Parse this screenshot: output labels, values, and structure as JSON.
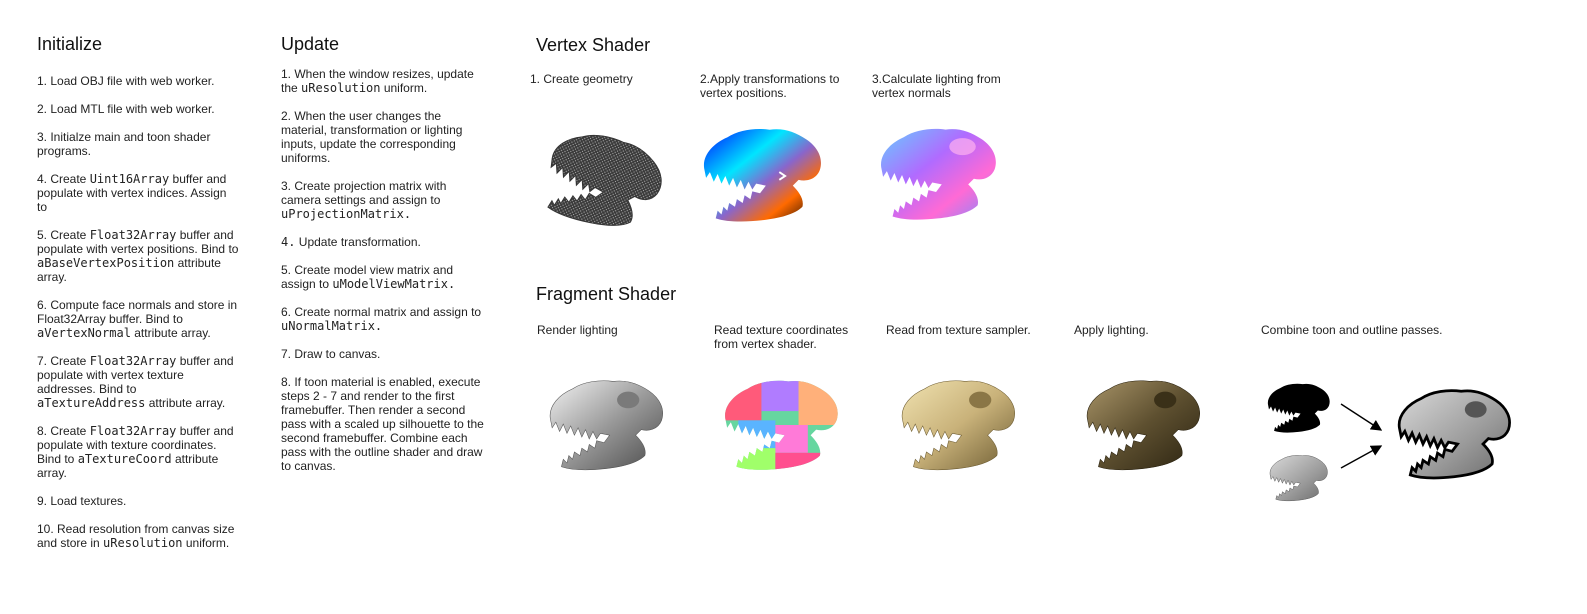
{
  "init": {
    "title": "Initialize",
    "steps": [
      {
        "parts": [
          {
            "t": "1. Load OBJ file with web worker."
          }
        ]
      },
      {
        "parts": [
          {
            "t": "2. Load MTL file with web worker."
          }
        ]
      },
      {
        "parts": [
          {
            "t": "3. Initialze main and toon shader programs."
          }
        ]
      },
      {
        "parts": [
          {
            "t": "4. Create "
          },
          {
            "c": "Uint16Array"
          },
          {
            "t": " buffer and populate with vertex indices.  Assign to"
          }
        ]
      },
      {
        "parts": [
          {
            "t": "5. Create "
          },
          {
            "c": "Float32Array"
          },
          {
            "t": " buffer and populate with vertex positions. Bind to "
          },
          {
            "c": "aBaseVertexPosition"
          },
          {
            "t": " attribute array."
          }
        ]
      },
      {
        "parts": [
          {
            "t": "6. Compute face normals and store in Float32Array buffer.  Bind to "
          },
          {
            "c": "aVertexNormal"
          },
          {
            "t": " attribute array."
          }
        ]
      },
      {
        "parts": [
          {
            "t": "7. Create "
          },
          {
            "c": "Float32Array"
          },
          {
            "t": " buffer and populate with vertex texture addresses. Bind to "
          },
          {
            "c": "aTextureAddress"
          },
          {
            "t": " attribute array."
          }
        ]
      },
      {
        "parts": [
          {
            "t": "8. Create "
          },
          {
            "c": "Float32Array"
          },
          {
            "t": " buffer and populate with texture coordinates. Bind to "
          },
          {
            "c": "aTextureCoord"
          },
          {
            "t": " attribute array."
          }
        ]
      },
      {
        "parts": [
          {
            "t": "9. Load textures."
          }
        ]
      },
      {
        "parts": [
          {
            "t": "10. Read resolution from canvas size and store in "
          },
          {
            "c": "uResolution"
          },
          {
            "t": " uniform."
          }
        ]
      }
    ]
  },
  "update": {
    "title": "Update",
    "steps": [
      {
        "parts": [
          {
            "t": "1. When the window resizes, update the "
          },
          {
            "c": "uResolution"
          },
          {
            "t": " uniform."
          }
        ]
      },
      {
        "parts": [
          {
            "t": "2. When the user changes the material, transformation or lighting inputs, update the corresponding uniforms."
          }
        ]
      },
      {
        "parts": [
          {
            "t": "3. Create projection matrix with camera settings and assign to "
          },
          {
            "c": "uProjectionMatrix."
          }
        ]
      },
      {
        "parts": [
          {
            "c": "4."
          },
          {
            "t": " Update transformation."
          }
        ]
      },
      {
        "parts": [
          {
            "t": "5. Create model view matrix and assign to "
          },
          {
            "c": "uModelViewMatrix."
          }
        ]
      },
      {
        "parts": [
          {
            "t": "6. Create normal matrix and assign to "
          },
          {
            "c": "uNormalMatrix."
          }
        ]
      },
      {
        "parts": [
          {
            "t": "7. Draw to canvas."
          }
        ]
      },
      {
        "parts": [
          {
            "t": "8. If toon material is enabled, execute steps 2 - 7 and render to the first framebuffer. Then render a second pass with a scaled up silhouette to the second framebuffer. Combine each pass with the outline shader and draw to canvas."
          }
        ]
      }
    ]
  },
  "vertex": {
    "title": "Vertex Shader",
    "captions": [
      "1. Create geometry",
      "2.Apply transformations to vertex positions.",
      "3.Calculate lighting from vertex normals"
    ]
  },
  "fragment": {
    "title": "Fragment Shader",
    "captions": [
      "Render lighting",
      "Read texture coordinates from vertex shader.",
      "Read from texture sampler.",
      "Apply lighting.",
      "Combine toon and outline passes."
    ]
  },
  "images": {
    "wireframe": "skull-wireframe-image",
    "transformed": "skull-transformed-image",
    "normals": "skull-normals-image",
    "lit": "skull-lit-image",
    "texcoords": "skull-texcoords-image",
    "textured": "skull-textured-image",
    "final": "skull-final-lit-image",
    "silhouette": "skull-silhouette-image",
    "small_toon": "skull-toon-small-image",
    "toon": "skull-toon-final-image",
    "arrows": "arrow-icon"
  }
}
